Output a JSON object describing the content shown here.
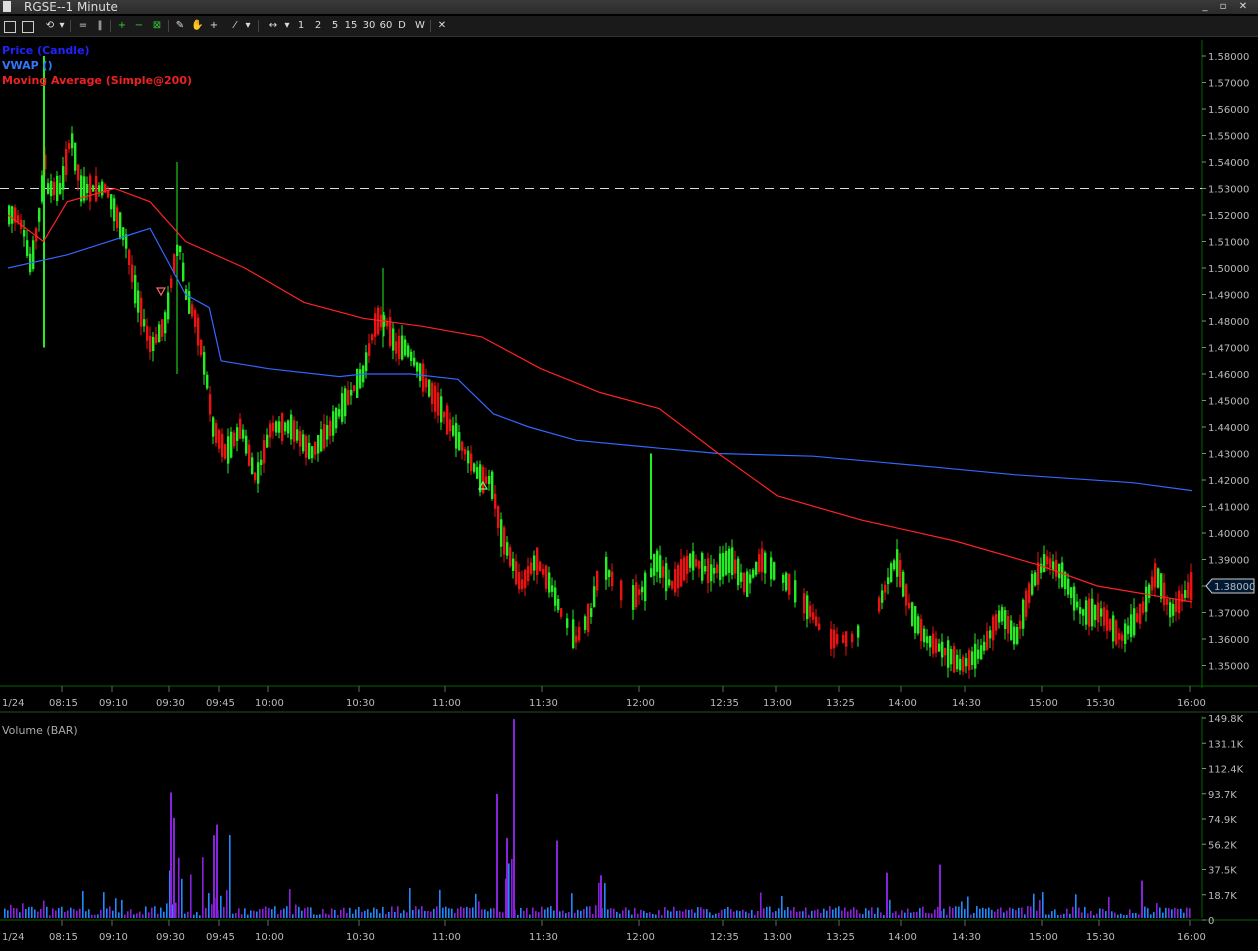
{
  "window": {
    "title": "RGSE--1 Minute",
    "buttons": [
      "_",
      "▫",
      "✕"
    ]
  },
  "toolbar": {
    "timeframes": [
      "1",
      "2",
      "5",
      "15",
      "30",
      "60",
      "D",
      "W"
    ],
    "close_label": "✕"
  },
  "legend": {
    "price": "Price (Candle)",
    "vwap": "VWAP ()",
    "ma": "Moving Average (Simple@200)",
    "volume": "Volume (BAR)"
  },
  "colors": {
    "up": "#22ee22",
    "down": "#ee1111",
    "vwap": "#3366ff",
    "ma": "#ff2222",
    "volume": "#8822dd",
    "volume_alt": "#2288ff",
    "grid_axis": "#006600"
  },
  "chart_data": [
    {
      "type": "candlestick",
      "title": "RGSE--1 Minute",
      "date_label": "1/24",
      "y_ticks": [
        "1.58000",
        "1.57000",
        "1.56000",
        "1.55000",
        "1.54000",
        "1.53000",
        "1.52000",
        "1.51000",
        "1.50000",
        "1.49000",
        "1.48000",
        "1.47000",
        "1.46000",
        "1.45000",
        "1.44000",
        "1.43000",
        "1.42000",
        "1.41000",
        "1.40000",
        "1.39000",
        "1.38000",
        "1.37000",
        "1.36000",
        "1.35000"
      ],
      "ylim": [
        1.345,
        1.585
      ],
      "x_ticks": [
        "08:15",
        "09:10",
        "09:30",
        "09:45",
        "10:00",
        "10:30",
        "11:00",
        "11:30",
        "12:00",
        "12:35",
        "13:00",
        "13:25",
        "14:00",
        "14:30",
        "15:00",
        "15:30",
        "16:00"
      ],
      "current_price": "1.38000",
      "reference_line": 1.53,
      "series": [
        {
          "name": "VWAP ()",
          "points": [
            [
              0,
              1.5
            ],
            [
              0.05,
              1.505
            ],
            [
              0.12,
              1.515
            ],
            [
              0.15,
              1.49
            ],
            [
              0.17,
              1.485
            ],
            [
              0.18,
              1.465
            ],
            [
              0.22,
              1.462
            ],
            [
              0.28,
              1.459
            ],
            [
              0.3,
              1.46
            ],
            [
              0.34,
              1.46
            ],
            [
              0.38,
              1.458
            ],
            [
              0.41,
              1.445
            ],
            [
              0.44,
              1.44
            ],
            [
              0.48,
              1.435
            ],
            [
              0.55,
              1.432
            ],
            [
              0.6,
              1.43
            ],
            [
              0.68,
              1.429
            ],
            [
              0.78,
              1.425
            ],
            [
              0.85,
              1.422
            ],
            [
              0.95,
              1.419
            ],
            [
              1.0,
              1.416
            ]
          ]
        },
        {
          "name": "Moving Average (Simple@200)",
          "points": [
            [
              0,
              1.52
            ],
            [
              0.03,
              1.51
            ],
            [
              0.05,
              1.525
            ],
            [
              0.09,
              1.53
            ],
            [
              0.12,
              1.525
            ],
            [
              0.15,
              1.51
            ],
            [
              0.2,
              1.5
            ],
            [
              0.25,
              1.487
            ],
            [
              0.3,
              1.481
            ],
            [
              0.35,
              1.478
            ],
            [
              0.4,
              1.474
            ],
            [
              0.45,
              1.462
            ],
            [
              0.5,
              1.453
            ],
            [
              0.55,
              1.447
            ],
            [
              0.6,
              1.43
            ],
            [
              0.65,
              1.414
            ],
            [
              0.72,
              1.405
            ],
            [
              0.8,
              1.397
            ],
            [
              0.87,
              1.388
            ],
            [
              0.92,
              1.38
            ],
            [
              1.0,
              1.374
            ]
          ]
        }
      ]
    },
    {
      "type": "bar",
      "title": "Volume (BAR)",
      "date_label": "1/24",
      "y_ticks": [
        "149.8K",
        "131.1K",
        "112.4K",
        "93.7K",
        "74.9K",
        "56.2K",
        "37.5K",
        "18.7K",
        "0"
      ],
      "ylim": [
        0,
        149800
      ]
    }
  ]
}
